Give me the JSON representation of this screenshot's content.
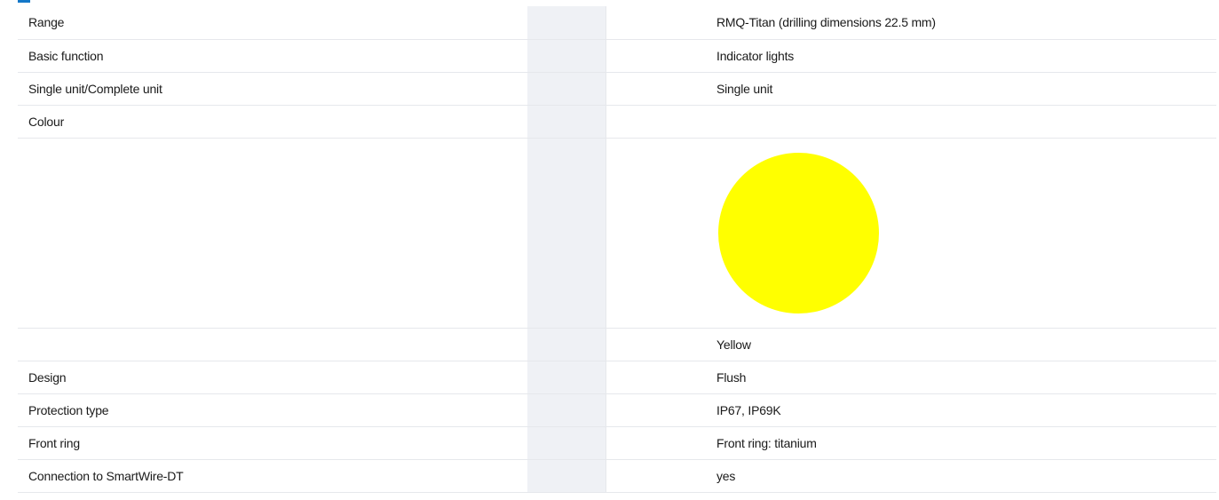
{
  "rows": [
    {
      "label": "Range",
      "value": "RMQ-Titan (drilling dimensions 22.5 mm)"
    },
    {
      "label": "Basic function",
      "value": "Indicator lights"
    },
    {
      "label": "Single unit/Complete unit",
      "value": "Single unit"
    },
    {
      "label": "Colour",
      "value": ""
    },
    {
      "label": "",
      "swatch_color": "#ffff00"
    },
    {
      "label": "",
      "value": "Yellow"
    },
    {
      "label": "Design",
      "value": "Flush"
    },
    {
      "label": "Protection type",
      "value": "IP67, IP69K"
    },
    {
      "label": "Front ring",
      "value": "Front ring: titanium"
    },
    {
      "label": "Connection to SmartWire-DT",
      "value": "yes"
    }
  ]
}
